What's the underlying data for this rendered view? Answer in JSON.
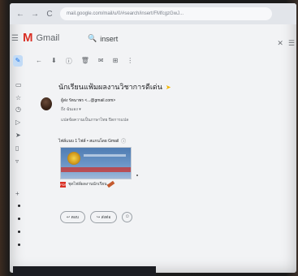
{
  "browser": {
    "nav_icons": [
      "←",
      "→",
      "C"
    ],
    "url": "mail.google.com/mail/u/0/#search/insert/FMfcgzGwJ..."
  },
  "gmail": {
    "logo_letter": "M",
    "logo_text": "Gmail",
    "search_query": "insert",
    "menu_icon": "☰",
    "search_icon": "🔍",
    "close_icon": "✕",
    "options_icon": "☰"
  },
  "toolbar": {
    "icons": [
      "←",
      "⬇",
      "ⓘ",
      "🗑",
      "✉",
      "⊞",
      "⋮"
    ]
  },
  "email": {
    "subject": "นักเรียนแฟ้มผลงานวิชาการดีเด่น",
    "important_icon": "➤",
    "sender": "ผู้ส่ง รัตนาพร <...@gmail.com>",
    "to": "ถึง ฉันเอง ▾",
    "translate": "แปลข้อความเป็นภาษาไทย  ปิดการแปล",
    "attachments_title": "ไฟล์แนบ 1 ไฟล์ • สแกนโดย Gmail",
    "attachment_name": "ชุดไฟล์ผลงานนักเรียน...",
    "pdf_label": "PDF"
  },
  "actions": {
    "reply": "↩  ตอบ",
    "forward": "↪  ส่งต่อ",
    "emoji_icon": "☺"
  }
}
